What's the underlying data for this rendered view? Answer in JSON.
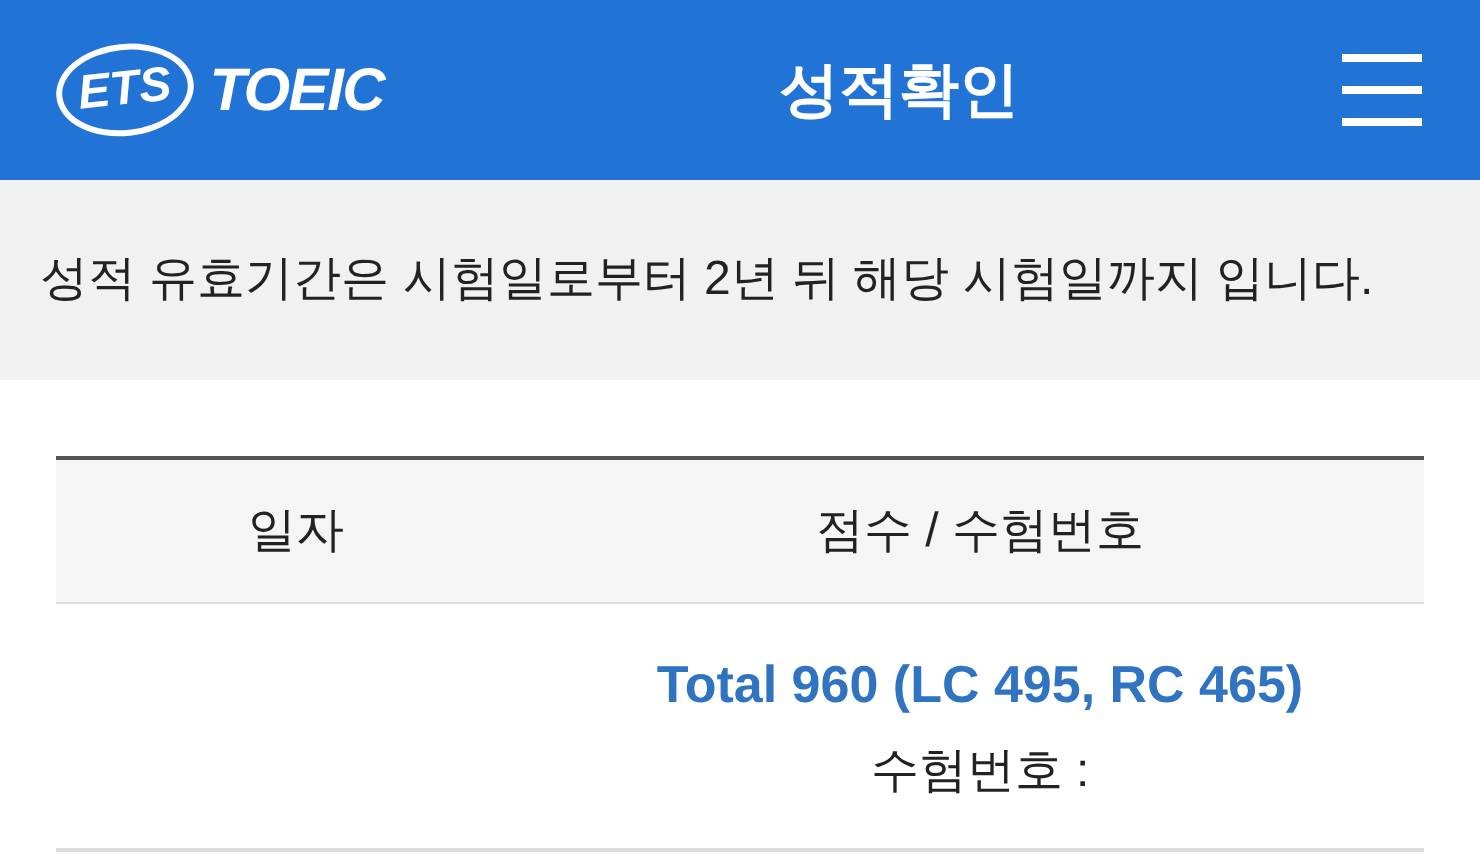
{
  "header": {
    "logo": {
      "ets": "ETS",
      "brand": "TOEIC"
    },
    "title": "성적확인"
  },
  "notice": "성적 유효기간은 시험일로부터 2년 뒤 해당 시험일까지 입니다.",
  "table": {
    "columns": [
      "일자",
      "점수 / 수험번호"
    ],
    "rows": [
      {
        "score": "Total 960 (LC 495, RC 465)",
        "id_label": "수험번호 :"
      }
    ]
  }
}
